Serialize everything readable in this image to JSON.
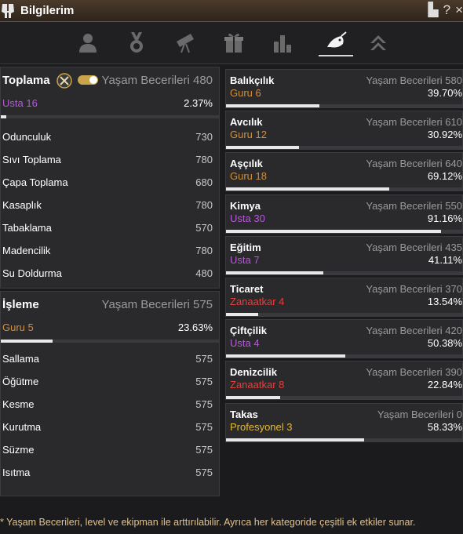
{
  "window": {
    "title": "Bilgilerim",
    "icons": [
      "spartan-helmet-icon",
      "document-icon",
      "help-icon",
      "close-icon"
    ]
  },
  "title_controls": {
    "doc": "▙",
    "help": "?",
    "close": "×"
  },
  "tabs": [
    {
      "name": "profile-tab",
      "icon": "person-icon",
      "active": false
    },
    {
      "name": "medal-tab",
      "icon": "medal-icon",
      "active": false
    },
    {
      "name": "telescope-tab",
      "icon": "telescope-icon",
      "active": false
    },
    {
      "name": "gift-tab",
      "icon": "gift-icon",
      "active": false
    },
    {
      "name": "stats-tab",
      "icon": "bar-chart-icon",
      "active": false
    },
    {
      "name": "life-skill-tab",
      "icon": "fishing-icon",
      "active": true
    },
    {
      "name": "rank-tab",
      "icon": "chevrons-up-icon",
      "active": false
    }
  ],
  "gathering": {
    "title": "Toplama",
    "life_label": "Yaşam Becerileri 480",
    "level": "Usta 16",
    "level_rank": "usta",
    "percent": "2.37%",
    "progress": 0.0237,
    "items": [
      {
        "name": "Odunculuk",
        "value": "730"
      },
      {
        "name": "Sıvı Toplama",
        "value": "780"
      },
      {
        "name": "Çapa Toplama",
        "value": "680"
      },
      {
        "name": "Kasaplık",
        "value": "780"
      },
      {
        "name": "Tabaklama",
        "value": "570"
      },
      {
        "name": "Madencilik",
        "value": "780"
      },
      {
        "name": "Su Doldurma",
        "value": "480"
      }
    ]
  },
  "processing": {
    "title": "İşleme",
    "life_label": "Yaşam Becerileri 575",
    "level": "Guru 5",
    "level_rank": "guru",
    "percent": "23.63%",
    "progress": 0.2363,
    "items": [
      {
        "name": "Sallama",
        "value": "575"
      },
      {
        "name": "Öğütme",
        "value": "575"
      },
      {
        "name": "Kesme",
        "value": "575"
      },
      {
        "name": "Kurutma",
        "value": "575"
      },
      {
        "name": "Süzme",
        "value": "575"
      },
      {
        "name": "Isıtma",
        "value": "575"
      }
    ]
  },
  "skills": [
    {
      "name": "Balıkçılık",
      "life": "Yaşam Becerileri 580",
      "level": "Guru 6",
      "rank": "guru",
      "percent": "39.70%",
      "progress": 0.397
    },
    {
      "name": "Avcılık",
      "life": "Yaşam Becerileri 610",
      "level": "Guru 12",
      "rank": "guru",
      "percent": "30.92%",
      "progress": 0.3092
    },
    {
      "name": "Aşçılık",
      "life": "Yaşam Becerileri 640",
      "level": "Guru 18",
      "rank": "guru",
      "percent": "69.12%",
      "progress": 0.6912
    },
    {
      "name": "Kimya",
      "life": "Yaşam Becerileri 550",
      "level": "Usta 30",
      "rank": "usta",
      "percent": "91.16%",
      "progress": 0.9116
    },
    {
      "name": "Eğitim",
      "life": "Yaşam Becerileri 435",
      "level": "Usta 7",
      "rank": "usta",
      "percent": "41.11%",
      "progress": 0.4111
    },
    {
      "name": "Ticaret",
      "life": "Yaşam Becerileri 370",
      "level": "Zanaatkar 4",
      "rank": "zanaatkar",
      "percent": "13.54%",
      "progress": 0.1354
    },
    {
      "name": "Çiftçilik",
      "life": "Yaşam Becerileri 420",
      "level": "Usta 4",
      "rank": "usta",
      "percent": "50.38%",
      "progress": 0.5038
    },
    {
      "name": "Denizcilik",
      "life": "Yaşam Becerileri 390",
      "level": "Zanaatkar 8",
      "rank": "zanaatkar",
      "percent": "22.84%",
      "progress": 0.2284
    },
    {
      "name": "Takas",
      "life": "Yaşam Becerileri 0",
      "level_rank_label": "Profesyonel",
      "level_num": "3",
      "level": "Profesyonel 3",
      "rank": "profesyonel",
      "percent": "58.33%",
      "progress": 0.5833
    }
  ],
  "footer": "* Yaşam Becerileri, level ve ekipman ile arttırılabilir. Ayrıca her kategoride çeşitli ek etkiler sunar.",
  "colors": {
    "usta": "#b45ad6",
    "guru": "#d08e3e",
    "zanaatkar": "#e0423c",
    "profesyonel": "#e6b93a",
    "accent": "#c9a44a"
  }
}
